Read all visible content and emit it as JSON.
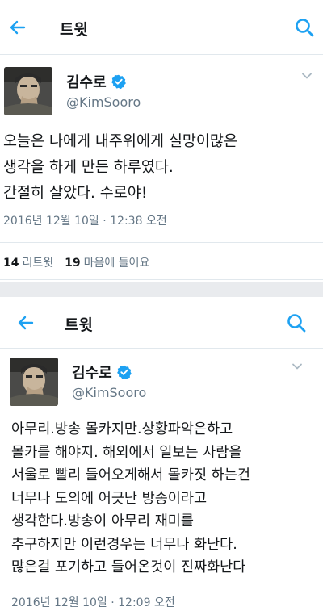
{
  "tweets": [
    {
      "header_title": "트윗",
      "author_name": "김수로",
      "author_handle": "@KimSooro",
      "text_lines": [
        "오늘은 나에게 내주위에게 실망이많은",
        "생각을 하게 만든 하루였다.",
        "간절히 살았다. 수로야!"
      ],
      "timestamp": "2016년 12월 10일 · 12:38 오전",
      "retweets": {
        "count": "14",
        "label": "리트윗"
      },
      "likes": {
        "count": "19",
        "label": "마음에 들어요"
      }
    },
    {
      "header_title": "트윗",
      "author_name": "김수로",
      "author_handle": "@KimSooro",
      "text_lines": [
        "아무리.방송 몰카지만.상황파악은하고",
        "몰카를 해야지. 해외에서 일보는 사람을",
        "서울로 빨리 들어오게해서 몰카짓 하는건",
        "너무나 도의에 어긋난 방송이라고",
        "생각한다.방송이 아무리 재미를",
        "추구하지만 이런경우는 너무나 화난다.",
        "많은걸 포기하고 들어온것이 진짜화난다"
      ],
      "timestamp": "2016년 12월 10일 · 12:09 오전"
    }
  ],
  "colors": {
    "accent": "#1da1f2",
    "text": "#14171a",
    "secondary": "#657786",
    "divider": "#e1e8ed"
  },
  "icons": [
    "back-arrow-icon",
    "search-icon",
    "verified-badge-icon",
    "chevron-down-icon"
  ]
}
